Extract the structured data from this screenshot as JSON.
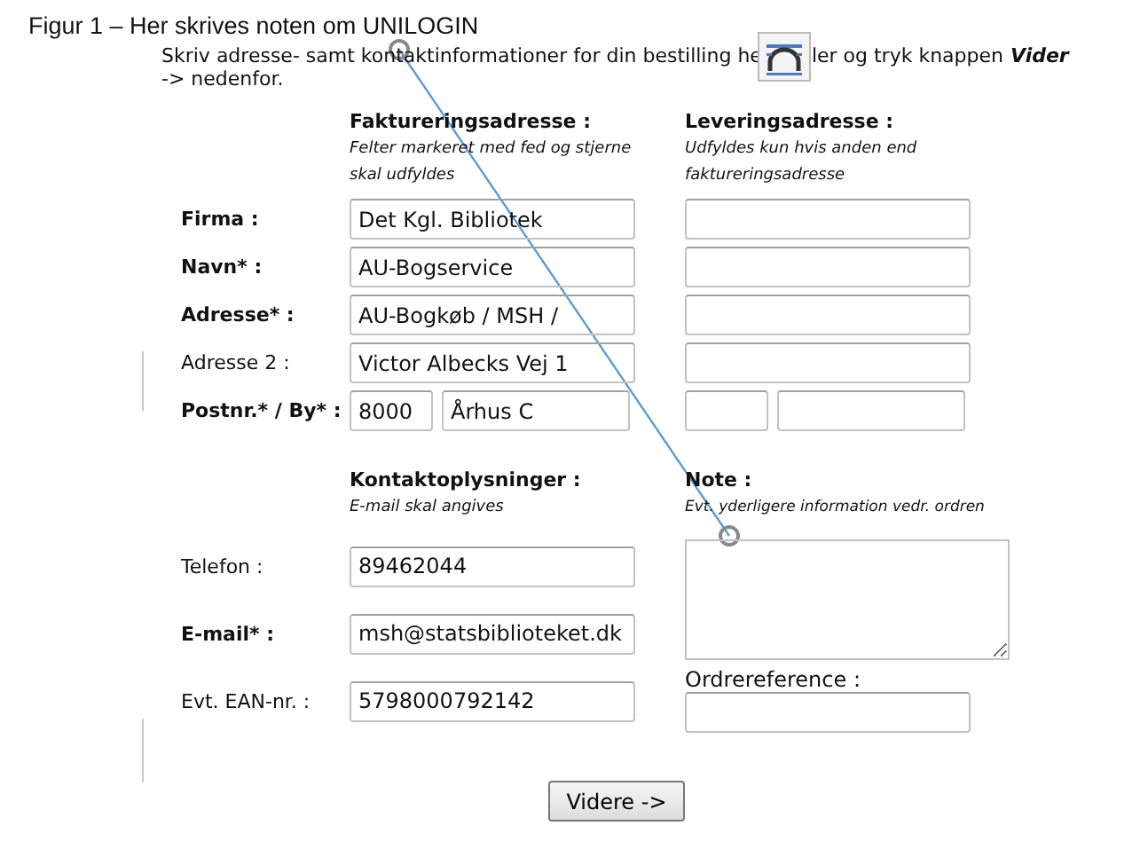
{
  "caption": "Figur 1 – Her skrives noten om UNILOGIN",
  "intro": {
    "part_1": "Skriv adresse- samt kontaktinformationer for din bestilling he",
    "part_2": "ler og tryk knappen",
    "button_reference": "Vider",
    "line_2": "-> nedenfor."
  },
  "billing": {
    "heading": "Faktureringsadresse :",
    "note": "Felter markeret med fed og stjerne skal udfyldes",
    "fields": [
      {
        "kind": "single",
        "label": "Firma :",
        "bold": true,
        "values": [
          "Det Kgl. Bibliotek"
        ]
      },
      {
        "kind": "single",
        "label": "Navn* :",
        "bold": true,
        "values": [
          "AU-Bogservice"
        ]
      },
      {
        "kind": "single",
        "label": "Adresse* :",
        "bold": true,
        "values": [
          "AU-Bogkøb / MSH /"
        ]
      },
      {
        "kind": "single",
        "label": "Adresse 2 :",
        "bold": false,
        "values": [
          "Victor Albecks Vej 1"
        ]
      },
      {
        "kind": "pair",
        "label": "Postnr.* / By* :",
        "bold": true,
        "values": [
          "8000",
          "Århus C"
        ]
      }
    ]
  },
  "delivery": {
    "heading": "Leveringsadresse :",
    "note": "Udfyldes kun hvis anden end faktureringsadresse",
    "fields": [
      {
        "kind": "single"
      },
      {
        "kind": "single"
      },
      {
        "kind": "single"
      },
      {
        "kind": "single"
      },
      {
        "kind": "pair"
      }
    ]
  },
  "contact": {
    "heading": "Kontaktoplysninger :",
    "note": "E-mail skal angives",
    "fields": [
      {
        "label": "Telefon :",
        "bold": false,
        "value": "89462044"
      },
      {
        "label": "E-mail* :",
        "bold": true,
        "value": "msh@statsbiblioteket.dk"
      },
      {
        "label": "Evt. EAN-nr. :",
        "bold": false,
        "value": "5798000792142"
      }
    ]
  },
  "note": {
    "heading": "Note :",
    "hint": "Evt. yderligere information vedr. ordren"
  },
  "order_reference": {
    "label": "Ordrereference :"
  },
  "submit": {
    "label": "Videre ->"
  }
}
